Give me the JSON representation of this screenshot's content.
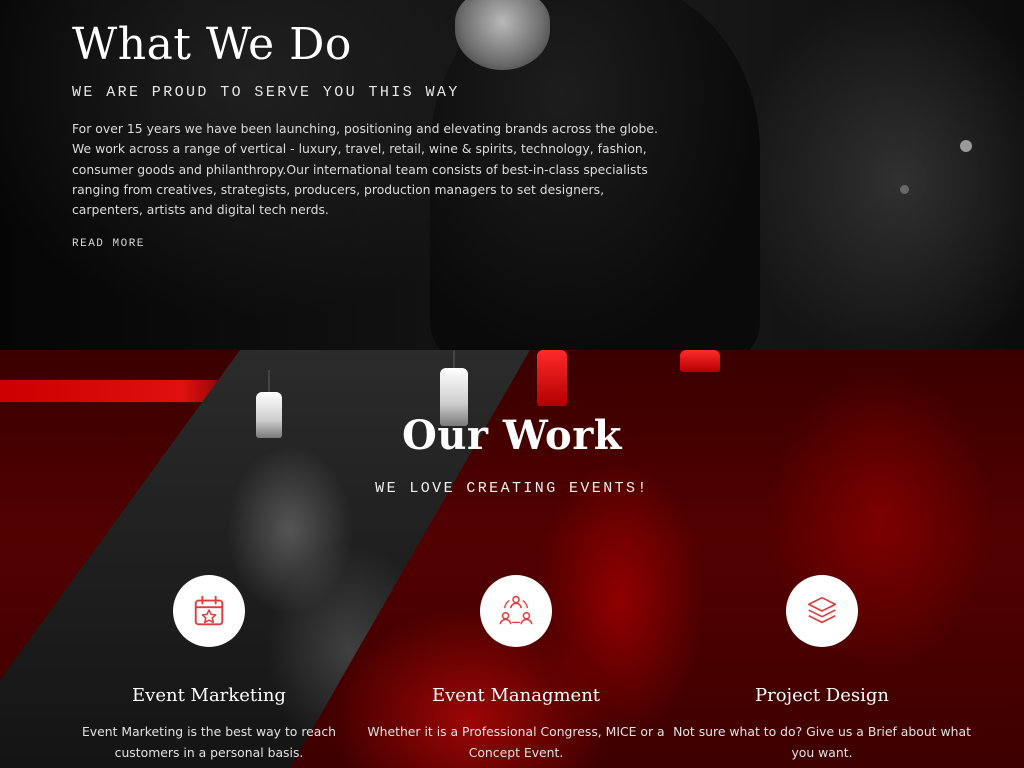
{
  "about": {
    "title": "What We Do",
    "subtitle": "WE ARE PROUD TO SERVE YOU THIS WAY",
    "body": "For over 15 years we have been launching, positioning and elevating brands across the globe. We work across a range of vertical - luxury, travel, retail, wine & spirits, technology, fashion, consumer goods and philanthropy.Our international team consists of best-in-class specialists ranging from creatives, strategists, producers, production managers to set designers, carpenters, artists and digital tech nerds.",
    "read_more": "READ MORE"
  },
  "work": {
    "title": "Our Work",
    "subtitle": "WE LOVE CREATING EVENTS!",
    "services": [
      {
        "icon": "calendar-star-icon",
        "title": "Event Marketing",
        "description": "Event Marketing is the best way to reach customers in a personal basis."
      },
      {
        "icon": "team-cycle-icon",
        "title": "Event Managment",
        "description": "Whether it is a Professional Congress, MICE or a Concept Event."
      },
      {
        "icon": "layers-icon",
        "title": "Project Design",
        "description": "Not sure what to do? Give us a Brief about what you want."
      }
    ]
  },
  "colors": {
    "accent": "#e23b3b",
    "section_red": "#520000",
    "text": "#ffffff"
  }
}
